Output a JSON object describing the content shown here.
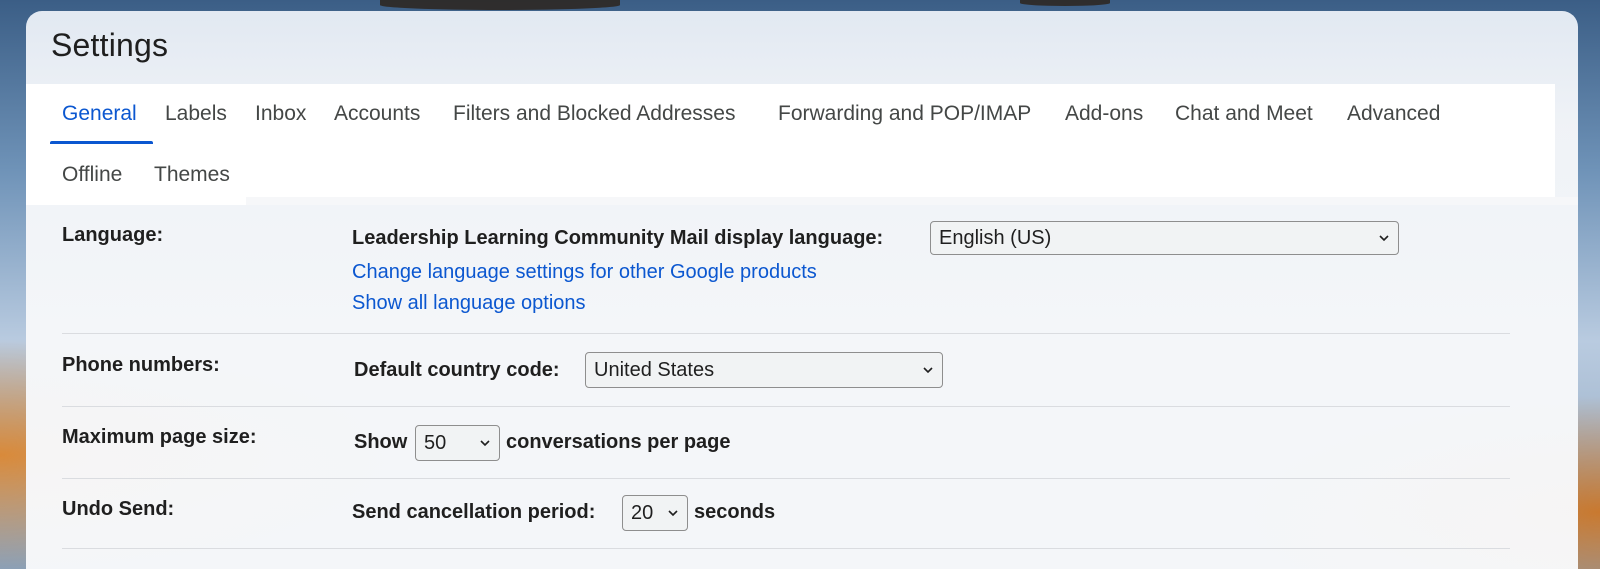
{
  "header": {
    "title": "Settings"
  },
  "tabs": [
    {
      "label": "General",
      "active": true
    },
    {
      "label": "Labels"
    },
    {
      "label": "Inbox"
    },
    {
      "label": "Accounts"
    },
    {
      "label": "Filters and Blocked Addresses"
    },
    {
      "label": "Forwarding and POP/IMAP"
    },
    {
      "label": "Add-ons"
    },
    {
      "label": "Chat and Meet"
    },
    {
      "label": "Advanced"
    },
    {
      "label": "Offline"
    },
    {
      "label": "Themes"
    }
  ],
  "settings": {
    "language": {
      "label": "Language:",
      "display_language_text": "Leadership Learning Community Mail display language:",
      "display_language_value": "English (US)",
      "link_other_products": "Change language settings for other Google products",
      "link_all_options": "Show all language options"
    },
    "phone": {
      "label": "Phone numbers:",
      "country_code_text": "Default country code:",
      "country_code_value": "United States"
    },
    "page_size": {
      "label": "Maximum page size:",
      "show_text": "Show",
      "value": "50",
      "suffix_text": "conversations per page"
    },
    "undo_send": {
      "label": "Undo Send:",
      "period_text": "Send cancellation period:",
      "value": "20",
      "suffix_text": "seconds"
    }
  },
  "colors": {
    "accent": "#0b57d0",
    "text": "#1f1f1f",
    "tab_text": "#444746"
  }
}
